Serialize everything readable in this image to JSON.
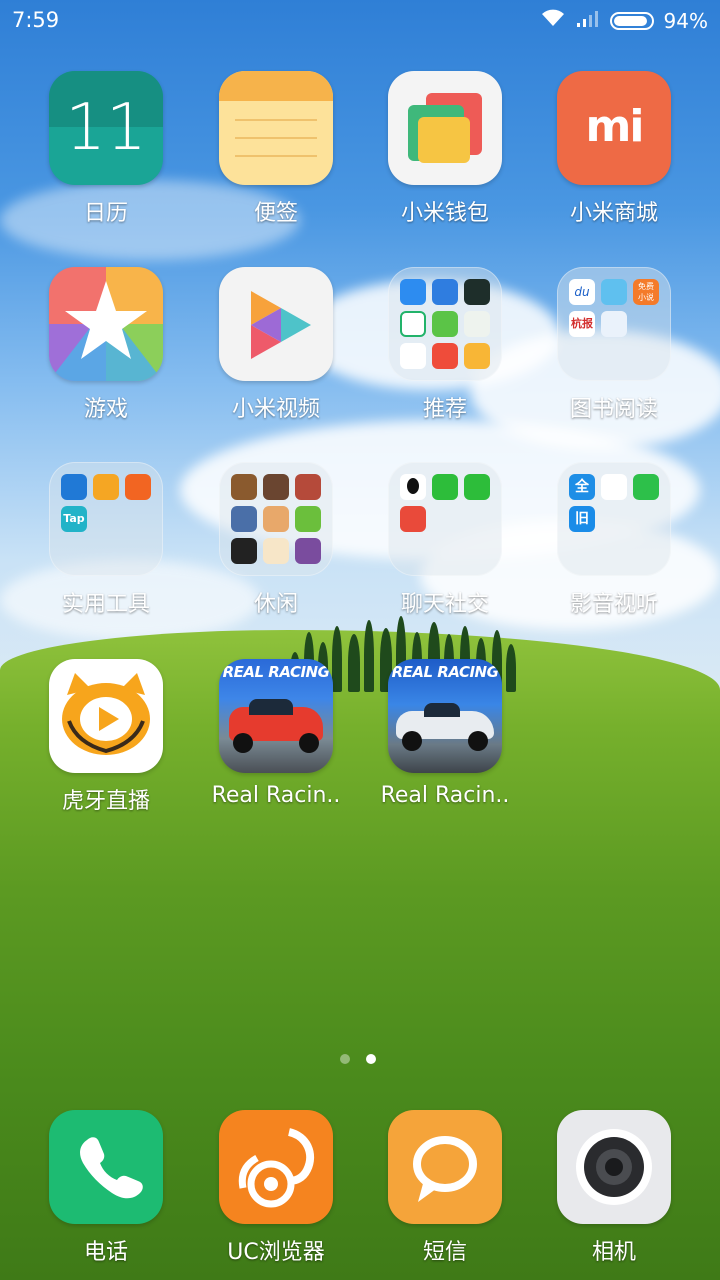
{
  "status_bar": {
    "time": "7:59",
    "battery": "94%",
    "battery_level": 0.94
  },
  "apps": {
    "calendar": {
      "label": "日历",
      "day": "11"
    },
    "notes": {
      "label": "便签"
    },
    "wallet": {
      "label": "小米钱包"
    },
    "mi_store": {
      "label": "小米商城",
      "logo": "mi"
    },
    "games": {
      "label": "游戏"
    },
    "mi_video": {
      "label": "小米视频"
    },
    "folder_recommend": {
      "label": "推荐"
    },
    "folder_books": {
      "label": "图书阅读",
      "tiles": [
        "du",
        "免费\n小说",
        "杭报"
      ]
    },
    "folder_tools": {
      "label": "实用工具",
      "tiles": [
        "Tap"
      ]
    },
    "folder_leisure": {
      "label": "休闲"
    },
    "folder_social": {
      "label": "聊天社交"
    },
    "folder_media": {
      "label": "影音视听",
      "tiles": [
        "全",
        "旧"
      ]
    },
    "huya": {
      "label": "虎牙直播"
    },
    "real_racing_1": {
      "label": "Real Racin..",
      "banner": "REAL RACING"
    },
    "real_racing_2": {
      "label": "Real Racin..",
      "banner": "REAL RACING"
    }
  },
  "page_indicator": {
    "count": 2,
    "active": 2
  },
  "dock": {
    "phone": {
      "label": "电话"
    },
    "uc_browser": {
      "label": "UC浏览器"
    },
    "sms": {
      "label": "短信"
    },
    "camera": {
      "label": "相机"
    }
  },
  "colors": {
    "calendar": "#1aa596",
    "notes": "#f6b34b",
    "mi_store": "#ee6a45",
    "phone": "#1dbb72",
    "uc": "#f5841f",
    "sms": "#f5a43a",
    "camera": "#e8e9ec"
  }
}
